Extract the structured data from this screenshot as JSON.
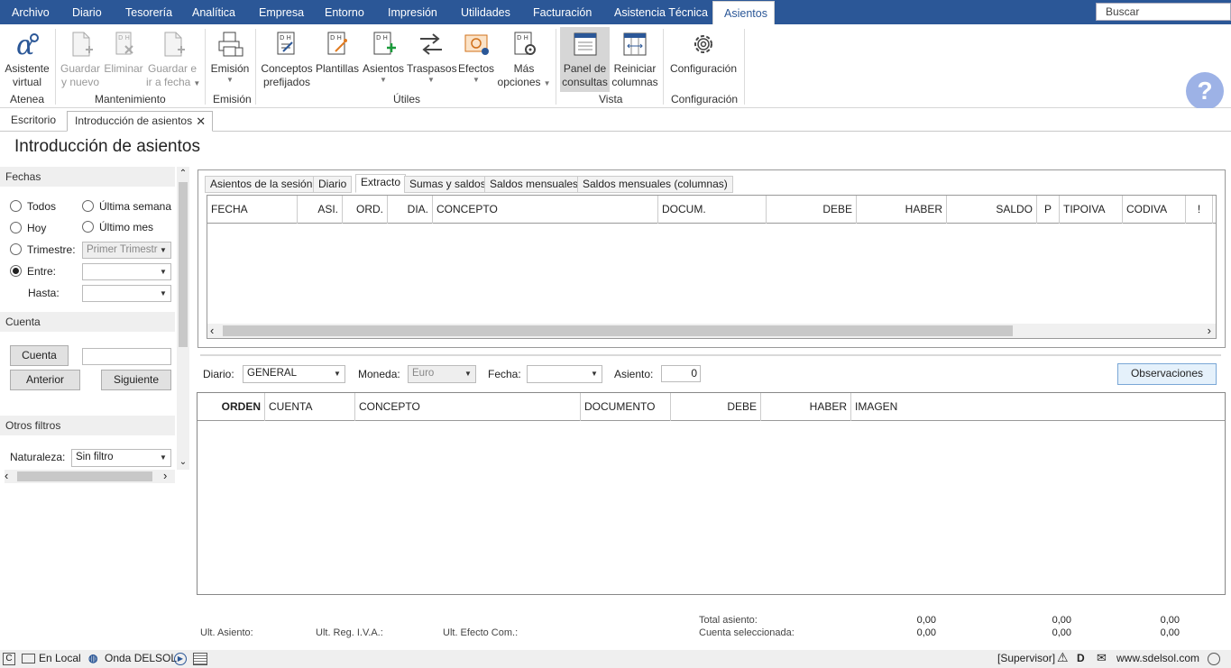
{
  "menubar": {
    "tabs": [
      "Archivo",
      "Diario",
      "Tesorería",
      "Analítica",
      "Empresa",
      "Entorno",
      "Impresión",
      "Utilidades",
      "Facturación",
      "Asistencia Técnica",
      "Asientos"
    ],
    "active_tab": "Asientos",
    "search_placeholder": "Buscar"
  },
  "ribbon": {
    "asistente": [
      "Asistente",
      "virtual"
    ],
    "guardar_nuevo": [
      "Guardar",
      "y nuevo"
    ],
    "eliminar": "Eliminar",
    "guardar_ir": [
      "Guardar e",
      "ir a fecha"
    ],
    "emision": "Emisión",
    "conceptos": [
      "Conceptos",
      "prefijados"
    ],
    "plantillas": "Plantillas",
    "asientos": "Asientos",
    "traspasos": "Traspasos",
    "efectos": "Efectos",
    "mas_opciones": [
      "Más",
      "opciones"
    ],
    "panel_consultas": [
      "Panel de",
      "consultas"
    ],
    "reiniciar": [
      "Reiniciar",
      "columnas"
    ],
    "configuracion": "Configuración",
    "groups": {
      "atenea": "Atenea",
      "mantenimiento": "Mantenimiento",
      "emision": "Emisión",
      "utiles": "Útiles",
      "vista": "Vista",
      "configuracion": "Configuración"
    }
  },
  "doc_tabs": {
    "escritorio": "Escritorio",
    "introduccion": "Introducción de asientos"
  },
  "page_title": "Introducción de asientos",
  "left_panel": {
    "fechas_title": "Fechas",
    "todos": "Todos",
    "ultima_semana": "Última semana",
    "hoy": "Hoy",
    "ultimo_mes": "Último mes",
    "trimestre": "Trimestre:",
    "trimestre_value": "Primer Trimestr",
    "entre": "Entre:",
    "hasta": "Hasta:",
    "cuenta_title": "Cuenta",
    "cuenta_btn": "Cuenta",
    "anterior_btn": "Anterior",
    "siguiente_btn": "Siguiente",
    "otros_filtros_title": "Otros filtros",
    "naturaleza_label": "Naturaleza:",
    "naturaleza_value": "Sin filtro"
  },
  "extract_tabs": [
    "Asientos de la sesión",
    "Diario",
    "Extracto",
    "Sumas y saldos",
    "Saldos mensuales",
    "Saldos mensuales (columnas)"
  ],
  "active_extract_tab": "Extracto",
  "grid1_columns": [
    "FECHA",
    "ASI.",
    "ORD.",
    "DIA.",
    "CONCEPTO",
    "DOCUM.",
    "DEBE",
    "HABER",
    "SALDO",
    "P",
    "TIPOIVA",
    "CODIVA",
    "!"
  ],
  "entry": {
    "diario_label": "Diario:",
    "diario_value": "GENERAL",
    "moneda_label": "Moneda:",
    "moneda_value": "Euro",
    "fecha_label": "Fecha:",
    "asiento_label": "Asiento:",
    "asiento_value": "0",
    "observaciones_btn": "Observaciones"
  },
  "grid2_columns": [
    "ORDEN",
    "CUENTA",
    "CONCEPTO",
    "DOCUMENTO",
    "DEBE",
    "HABER",
    "IMAGEN"
  ],
  "footer": {
    "ult_asiento": "Ult. Asiento:",
    "ult_reg_iva": "Ult. Reg. I.V.A.:",
    "ult_efecto": "Ult. Efecto Com.:",
    "total_asiento": "Total asiento:",
    "cuenta_seleccionada": "Cuenta seleccionada:",
    "totals_row1": [
      "0,00",
      "0,00",
      "0,00"
    ],
    "totals_row2": [
      "0,00",
      "0,00",
      "0,00"
    ]
  },
  "statusbar": {
    "en_local": "En Local",
    "onda": "Onda DELSOL",
    "supervisor": "[Supervisor]",
    "website": "www.sdelsol.com"
  }
}
